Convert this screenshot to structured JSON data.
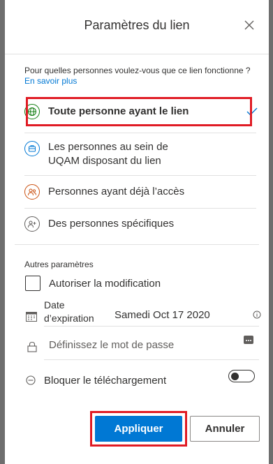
{
  "dialog": {
    "title": "Paramètres du lien"
  },
  "audience": {
    "question": "Pour quelles personnes voulez-vous que ce lien fonctionne ?",
    "learn_more": "En savoir plus",
    "options": [
      {
        "label": "Toute personne ayant le lien",
        "icon": "globe-icon",
        "selected": true
      },
      {
        "label": "Les personnes au sein de UQAM disposant du lien",
        "icon": "building-icon",
        "selected": false
      },
      {
        "label": "Personnes ayant déjà l’accès",
        "icon": "people-icon",
        "selected": false
      },
      {
        "label": "Des personnes spécifiques",
        "icon": "people-add-icon",
        "selected": false
      }
    ]
  },
  "settings": {
    "section_label": "Autres paramètres",
    "allow_edit_label": "Autoriser la modification",
    "expiration_label_line1": "Date",
    "expiration_label_line2": "d’expiration",
    "expiration_value": "Samedi Oct 17 2020",
    "password_placeholder": "Définissez le mot de passe",
    "block_download_label": "Bloquer le téléchargement",
    "block_download_on": false
  },
  "buttons": {
    "apply": "Appliquer",
    "cancel": "Annuler"
  },
  "colors": {
    "accent": "#0078d4",
    "highlight": "#e01b24",
    "globe": "#107c10",
    "building": "#0078d4",
    "people": "#ca5010",
    "text": "#323130"
  }
}
